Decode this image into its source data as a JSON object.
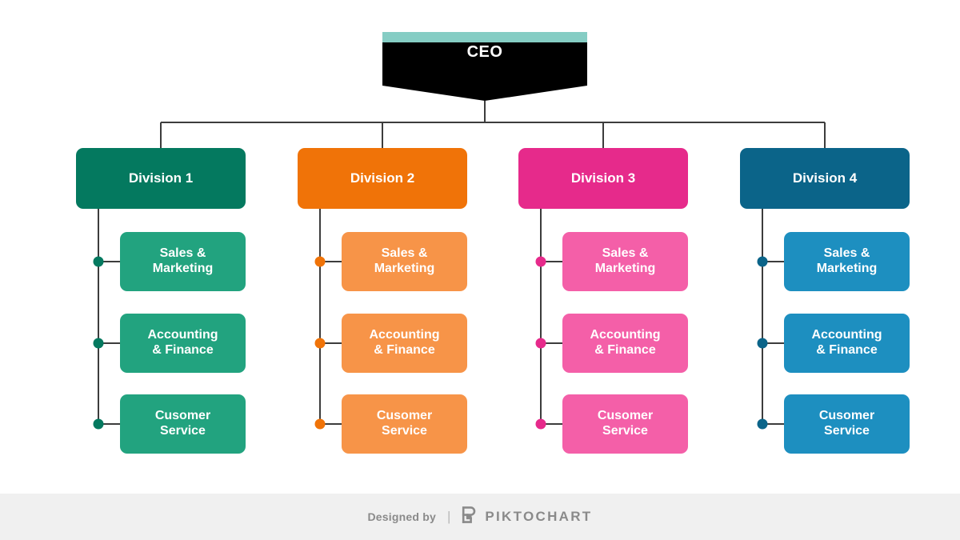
{
  "chart": {
    "type": "org-chart",
    "background": "#ffffff",
    "connector_color": "#3c3c3c",
    "root": {
      "label": "CEO",
      "accent_bar_color": "#85cdc4",
      "body_color": "#000000",
      "text_color": "#ffffff"
    },
    "columns": [
      {
        "division_label": "Division 1",
        "division_color": "#04795f",
        "sub_color": "#22a37f",
        "dot_color": "#04795f",
        "children": [
          {
            "line1": "Sales &",
            "line2": "Marketing"
          },
          {
            "line1": "Accounting",
            "line2": "& Finance"
          },
          {
            "line1": "Cusomer",
            "line2": "Service"
          }
        ]
      },
      {
        "division_label": "Division 2",
        "division_color": "#f07308",
        "sub_color": "#f79448",
        "dot_color": "#f07308",
        "children": [
          {
            "line1": "Sales &",
            "line2": "Marketing"
          },
          {
            "line1": "Accounting",
            "line2": "& Finance"
          },
          {
            "line1": "Cusomer",
            "line2": "Service"
          }
        ]
      },
      {
        "division_label": "Division 3",
        "division_color": "#e62a8b",
        "sub_color": "#f45fa8",
        "dot_color": "#e62a8b",
        "children": [
          {
            "line1": "Sales &",
            "line2": "Marketing"
          },
          {
            "line1": "Accounting",
            "line2": "& Finance"
          },
          {
            "line1": "Cusomer",
            "line2": "Service"
          }
        ]
      },
      {
        "division_label": "Division 4",
        "division_color": "#0b6489",
        "sub_color": "#1d8fc0",
        "dot_color": "#0b6489",
        "children": [
          {
            "line1": "Sales &",
            "line2": "Marketing"
          },
          {
            "line1": "Accounting",
            "line2": "& Finance"
          },
          {
            "line1": "Cusomer",
            "line2": "Service"
          }
        ]
      }
    ]
  },
  "footer": {
    "designed_by": "Designed by",
    "separator": "|",
    "brand_name": "PIKTOCHART",
    "logo_icon": "piktochart-p-logo-icon",
    "background": "#f0f0f0",
    "text_color": "#8a8a8a"
  }
}
